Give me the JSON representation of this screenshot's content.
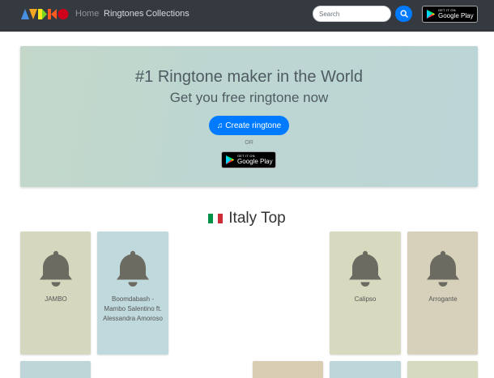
{
  "nav": {
    "logo_colors": [
      "#4a90e2",
      "#f5a623",
      "#f8e71c",
      "#7ed321",
      "#ff5a1f",
      "#d0021b"
    ],
    "links": [
      {
        "label": "Home",
        "active": true
      },
      {
        "label": "Ringtones",
        "active": false
      },
      {
        "label": "Collections",
        "active": false
      }
    ],
    "search": {
      "placeholder": "Search",
      "value": "",
      "icon": "search-icon"
    },
    "store_badge": {
      "small": "GET IT ON",
      "big": "Google Play"
    }
  },
  "hero": {
    "title": "#1 Ringtone maker in the World",
    "subtitle": "Get you free ringtone now",
    "create_button": {
      "icon": "music-note-icon",
      "label": "Create ringtone"
    },
    "or_label": "OR",
    "store_badge": {
      "small": "GET IT ON",
      "big": "Google Play"
    }
  },
  "section": {
    "title": "Italy Top",
    "flag_colors": [
      "#009246",
      "#ffffff",
      "#ce2b37"
    ]
  },
  "cards": [
    {
      "name": "JAMBO",
      "color": "#d5d8bf",
      "icon": "bell-icon"
    },
    {
      "name": "Boomdabash - Mambo Salentino ft. Alessandra Amoroso",
      "color": "#c0d9dc",
      "icon": "bell-icon"
    },
    {
      "name": "Calipso",
      "color": "#d7dabf",
      "icon": "bell-icon"
    },
    {
      "name": "Arrogante",
      "color": "#d7d1bb",
      "icon": "bell-icon"
    }
  ],
  "partial_cards": [
    {
      "color": "#bfd6d8"
    },
    {
      "color": "#d9cdb4"
    },
    {
      "color": "#bdd6d9"
    },
    {
      "color": "#d6dabf"
    }
  ],
  "colors": {
    "accent": "#007bff",
    "navbar": "#343a40",
    "bell": "#6b6b62"
  }
}
